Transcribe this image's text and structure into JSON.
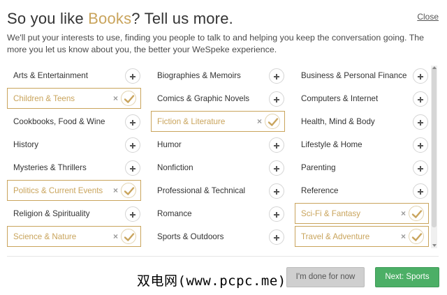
{
  "header": {
    "title_prefix": "So you like ",
    "title_highlight": "Books",
    "title_suffix": "? Tell us more.",
    "close_label": "Close",
    "subtitle": "We'll put your interests to use, finding you people to talk to and helping you keep the conversation going. The more you let us know about you, the better your WeSpeke experience."
  },
  "columns": [
    [
      {
        "label": "Arts & Entertainment",
        "selected": false
      },
      {
        "label": "Children & Teens",
        "selected": true
      },
      {
        "label": "Cookbooks, Food & Wine",
        "selected": false
      },
      {
        "label": "History",
        "selected": false
      },
      {
        "label": "Mysteries & Thrillers",
        "selected": false
      },
      {
        "label": "Politics & Current Events",
        "selected": true
      },
      {
        "label": "Religion & Spirituality",
        "selected": false
      },
      {
        "label": "Science & Nature",
        "selected": true
      }
    ],
    [
      {
        "label": "Biographies & Memoirs",
        "selected": false
      },
      {
        "label": "Comics & Graphic Novels",
        "selected": false
      },
      {
        "label": "Fiction & Literature",
        "selected": true
      },
      {
        "label": "Humor",
        "selected": false
      },
      {
        "label": "Nonfiction",
        "selected": false
      },
      {
        "label": "Professional & Technical",
        "selected": false
      },
      {
        "label": "Romance",
        "selected": false
      },
      {
        "label": "Sports & Outdoors",
        "selected": false
      }
    ],
    [
      {
        "label": "Business & Personal Finance",
        "selected": false
      },
      {
        "label": "Computers & Internet",
        "selected": false
      },
      {
        "label": "Health, Mind & Body",
        "selected": false
      },
      {
        "label": "Lifestyle & Home",
        "selected": false
      },
      {
        "label": "Parenting",
        "selected": false
      },
      {
        "label": "Reference",
        "selected": false
      },
      {
        "label": "Sci-Fi & Fantasy",
        "selected": true
      },
      {
        "label": "Travel & Adventure",
        "selected": true
      }
    ]
  ],
  "footer": {
    "watermark": "双电网(www.pcpc.me)",
    "done_label": "I'm done for now",
    "next_label": "Next: Sports"
  },
  "colors": {
    "accent": "#c9a45c",
    "next_button": "#4caf66"
  },
  "icons": {
    "add": "plus-icon",
    "selected": "checkmark-icon",
    "remove": "remove-x-icon"
  }
}
